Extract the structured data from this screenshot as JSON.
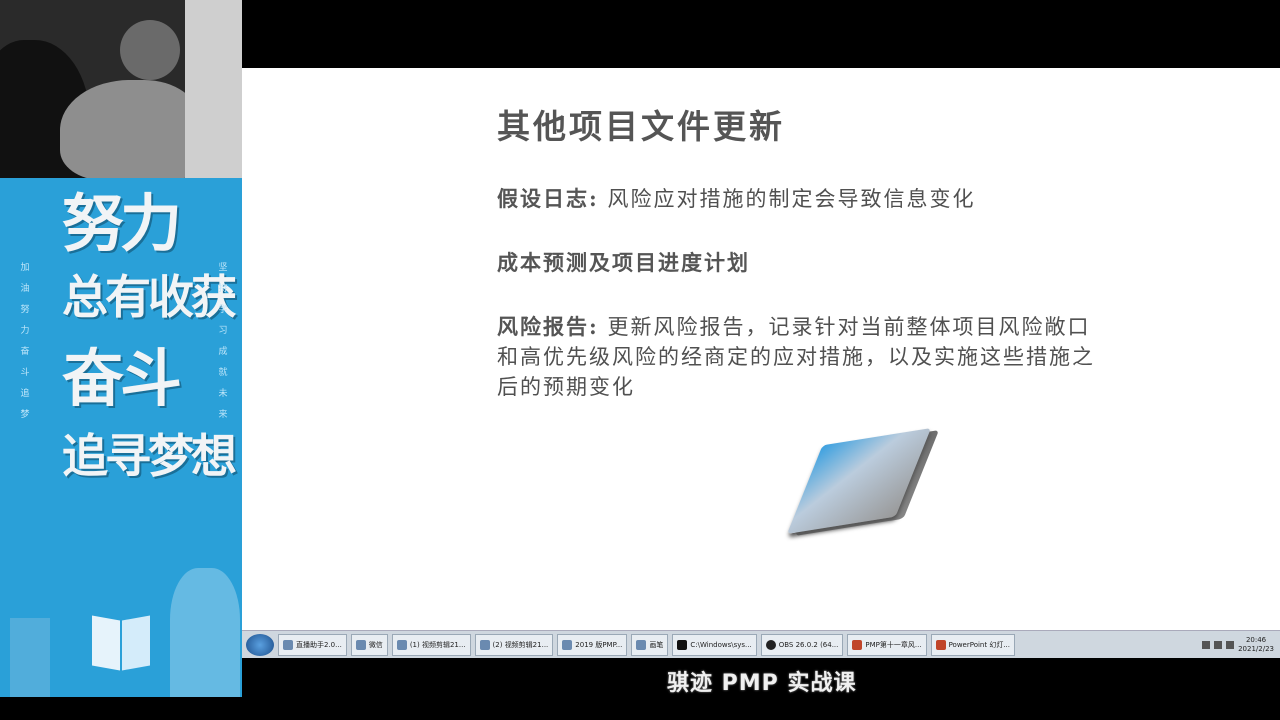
{
  "banner": {
    "line1": "努力",
    "line2": "总有收获",
    "line3": "奋斗",
    "line4": "追寻梦想",
    "left_vertical": "加油努力奋斗追梦",
    "right_vertical": "坚持学习成就未来"
  },
  "slide": {
    "title": "其他项目文件更新",
    "items": [
      {
        "label": "假设日志",
        "sep": ":",
        "text": "风险应对措施的制定会导致信息变化"
      },
      {
        "label": "成本预测及项目进度计划",
        "sep": "",
        "text": ""
      },
      {
        "label": "风险报告",
        "sep": ":",
        "text": "更新风险报告，记录针对当前整体项目风险敞口和高优先级风险的经商定的应对措施，以及实施这些措施之后的预期变化"
      }
    ]
  },
  "taskbar": {
    "tasks": [
      {
        "label": "直播助手2.0...",
        "style": ""
      },
      {
        "label": "微信",
        "style": ""
      },
      {
        "label": "(1) 视频剪辑21...",
        "style": ""
      },
      {
        "label": "(2) 视频剪辑21...",
        "style": ""
      },
      {
        "label": "2019 版PMP...",
        "style": ""
      },
      {
        "label": "画笔",
        "style": ""
      },
      {
        "label": "C:\\Windows\\sys...",
        "style": "dark"
      },
      {
        "label": "OBS 26.0.2 (64...",
        "style": "obs"
      },
      {
        "label": "PMP第十一章风...",
        "style": "ppt"
      },
      {
        "label": "PowerPoint 幻灯...",
        "style": "ppt"
      }
    ],
    "time": "20:46",
    "date": "2021/2/23"
  },
  "caption": "骐迹 PMP 实战课",
  "colors": {
    "banner": "#2aa0d8",
    "slide_bg": "#ffffff",
    "text": "#505050",
    "taskbar": "#cfd7df"
  }
}
